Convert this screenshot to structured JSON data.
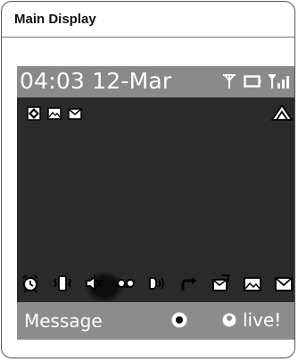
{
  "panel": {
    "title": "Main Display"
  },
  "status": {
    "time": "04:03",
    "date": "12-Mar",
    "icons": [
      "antenna-icon",
      "battery-icon",
      "signal-strength-icon"
    ]
  },
  "top_icons": [
    "silent-mode-icon",
    "mms-icon",
    "sms-icon"
  ],
  "corner_icon": "landscape-mode-icon",
  "indicator_icons": [
    "alarm-icon",
    "vibrate-icon",
    "mute-icon",
    "voicemail-icon",
    "speaker-icon",
    "call-forward-icon",
    "email-icon",
    "mms-full-icon",
    "message-full-icon"
  ],
  "softkeys": {
    "left": "Message",
    "center": "ok-icon",
    "right": "live!"
  },
  "colors": {
    "bar_gray": "#8a8a8a",
    "text": "#ffffff",
    "frame_border": "#555555"
  }
}
